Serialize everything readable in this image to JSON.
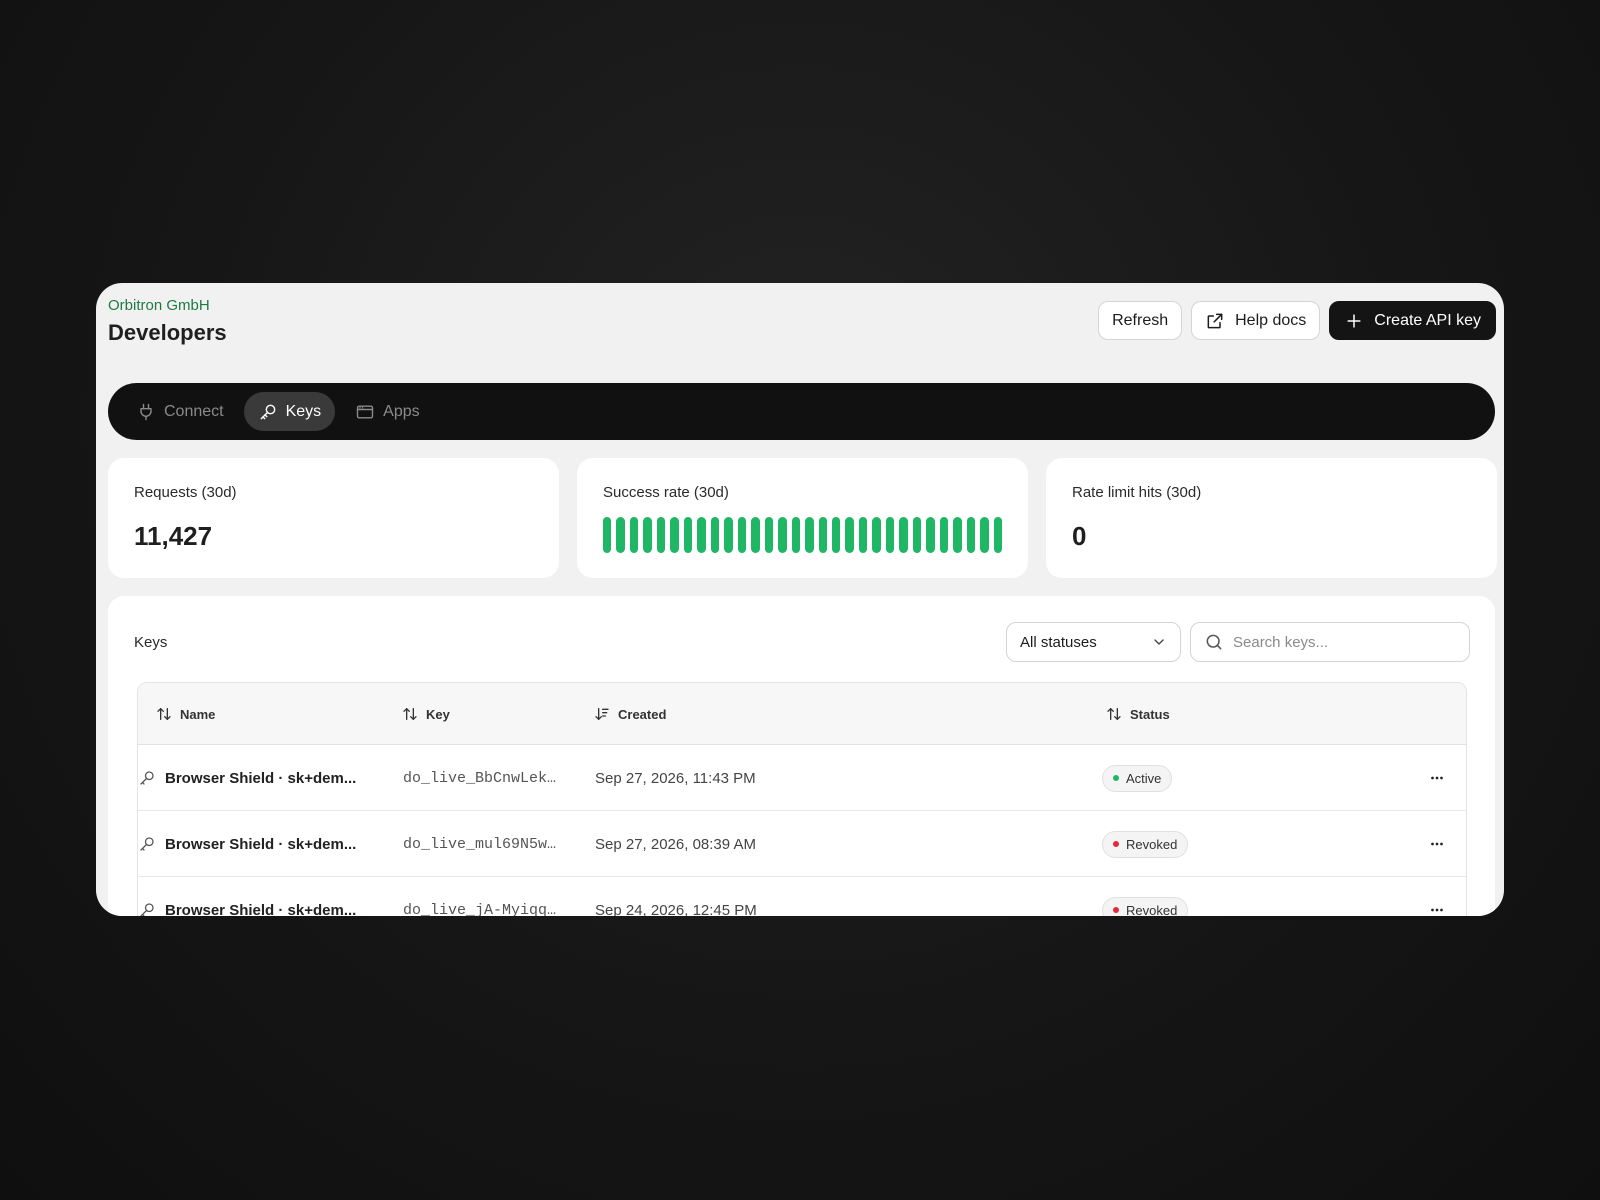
{
  "header": {
    "org": "Orbitron GmbH",
    "title": "Developers",
    "refresh_label": "Refresh",
    "help_label": "Help docs",
    "create_label": "Create API key"
  },
  "nav": {
    "tabs": [
      {
        "label": "Connect",
        "icon": "plug-icon",
        "active": false
      },
      {
        "label": "Keys",
        "icon": "key-icon",
        "active": true
      },
      {
        "label": "Apps",
        "icon": "app-window-icon",
        "active": false
      }
    ]
  },
  "stats": {
    "requests": {
      "label": "Requests (30d)",
      "value": "11,427"
    },
    "success": {
      "label": "Success rate (30d)",
      "bar_count": 30,
      "bar_color": "#1fb765"
    },
    "rate_limit": {
      "label": "Rate limit hits (30d)",
      "value": "0"
    }
  },
  "keys": {
    "title": "Keys",
    "filter_value": "All statuses",
    "search_placeholder": "Search keys...",
    "columns": {
      "name": "Name",
      "key": "Key",
      "created": "Created",
      "status": "Status"
    },
    "rows": [
      {
        "name": "Browser Shield · sk+dem...",
        "key": "do_live_BbCnwLek…",
        "created": "Sep 27, 2026, 11:43 PM",
        "status": "Active",
        "status_color": "#1fb765"
      },
      {
        "name": "Browser Shield · sk+dem...",
        "key": "do_live_mul69N5w…",
        "created": "Sep 27, 2026, 08:39 AM",
        "status": "Revoked",
        "status_color": "#e5283b"
      },
      {
        "name": "Browser Shield · sk+dem...",
        "key": "do_live_jA-Myiqq…",
        "created": "Sep 24, 2026, 12:45 PM",
        "status": "Revoked",
        "status_color": "#e5283b"
      }
    ]
  },
  "colors": {
    "accent_green": "#1e7a45",
    "primary_button": "#141414"
  }
}
